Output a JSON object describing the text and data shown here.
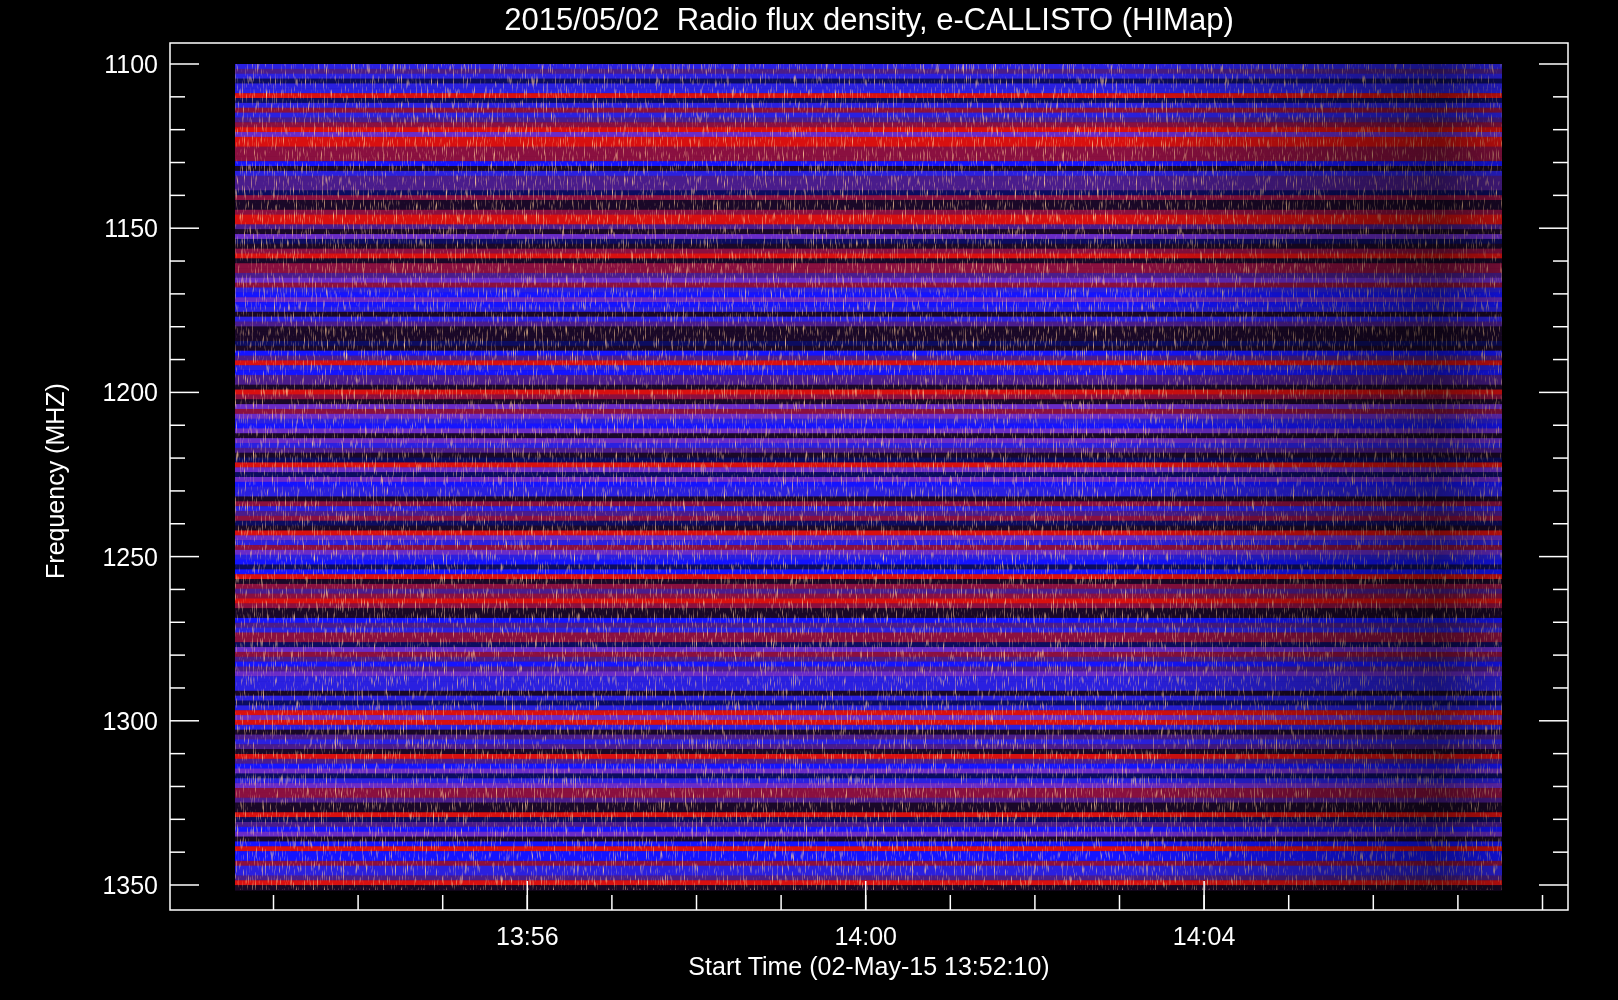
{
  "title": "2015/05/02  Radio flux density, e-CALLISTO (HIMap)",
  "y_axis": {
    "label": "Frequency (MHZ)",
    "ticks": [
      "1100",
      "1150",
      "1200",
      "1250",
      "1300",
      "1350"
    ]
  },
  "x_axis": {
    "label": "Start Time (02-May-15 13:52:10)",
    "ticks": [
      "13:56",
      "14:00",
      "14:04"
    ]
  }
}
